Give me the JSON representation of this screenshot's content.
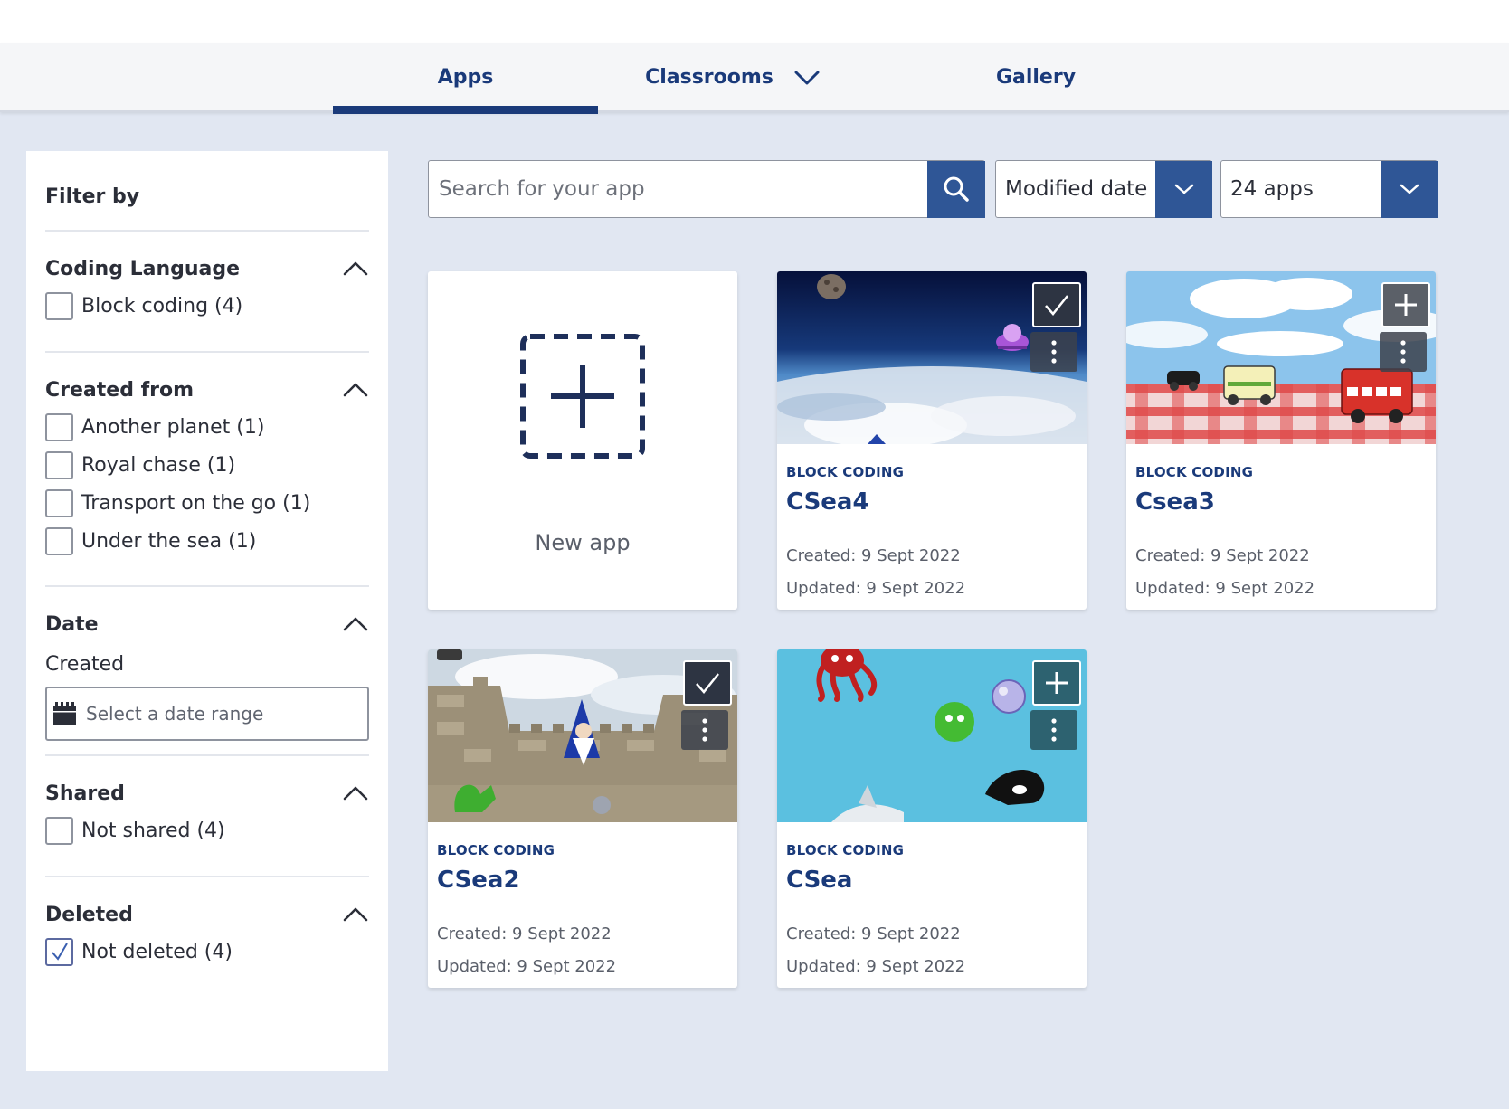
{
  "nav": {
    "tabs": [
      {
        "label": "Apps"
      },
      {
        "label": "Classrooms"
      },
      {
        "label": "Gallery"
      }
    ]
  },
  "filters": {
    "title": "Filter by",
    "coding_language": {
      "title": "Coding Language",
      "options": [
        {
          "label": "Block coding (4)",
          "checked": false
        }
      ]
    },
    "created_from": {
      "title": "Created from",
      "options": [
        {
          "label": "Another planet (1)",
          "checked": false
        },
        {
          "label": "Royal chase (1)",
          "checked": false
        },
        {
          "label": "Transport on the go (1)",
          "checked": false
        },
        {
          "label": "Under the sea (1)",
          "checked": false
        }
      ]
    },
    "date": {
      "title": "Date",
      "created_label": "Created",
      "date_placeholder": "Select a date range"
    },
    "shared": {
      "title": "Shared",
      "options": [
        {
          "label": "Not shared (4)",
          "checked": false
        }
      ]
    },
    "deleted": {
      "title": "Deleted",
      "options": [
        {
          "label": "Not deleted (4)",
          "checked": true
        }
      ]
    }
  },
  "toolbar": {
    "search_placeholder": "Search for your app",
    "sort_value": "Modified date",
    "count_value": "24 apps"
  },
  "new_app": {
    "label": "New app"
  },
  "apps": [
    {
      "tag": "BLOCK CODING",
      "name": "CSea4",
      "created": "Created: 9 Sept 2022",
      "updated": "Updated: 9 Sept 2022",
      "overlay": "check",
      "theme": "space"
    },
    {
      "tag": "BLOCK CODING",
      "name": "Csea3",
      "created": "Created: 9 Sept 2022",
      "updated": "Updated: 9 Sept 2022",
      "overlay": "plus",
      "theme": "picnic"
    },
    {
      "tag": "BLOCK CODING",
      "name": "CSea2",
      "created": "Created: 9 Sept 2022",
      "updated": "Updated: 9 Sept 2022",
      "overlay": "check",
      "theme": "castle"
    },
    {
      "tag": "BLOCK CODING",
      "name": "CSea",
      "created": "Created: 9 Sept 2022",
      "updated": "Updated: 9 Sept 2022",
      "overlay": "plus",
      "theme": "sea"
    }
  ],
  "colors": {
    "brand": "#1a3a7a",
    "button": "#2f5696",
    "background": "#e1e7f2"
  }
}
